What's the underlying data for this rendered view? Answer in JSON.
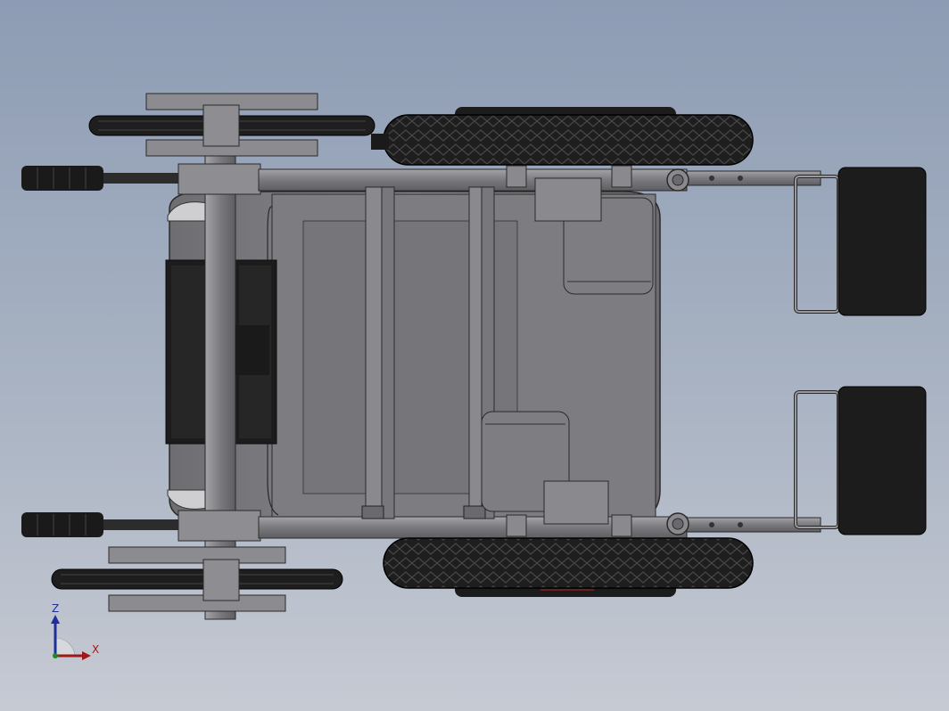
{
  "viewport": {
    "background_top": "#8d9cb4",
    "background_bottom": "#c6cad3"
  },
  "model": {
    "description_icon": "wheelchair-cad-model",
    "body_color": "#7c7c80",
    "frame_color": "#8e8e92",
    "tire_color": "#1e1e1e",
    "edge_color": "#2a2a2a"
  },
  "triad": {
    "z_label": "Z",
    "x_label": "X",
    "z_color": "#1f2f9a",
    "x_color": "#a01818",
    "origin_color": "#1d8a2a"
  }
}
